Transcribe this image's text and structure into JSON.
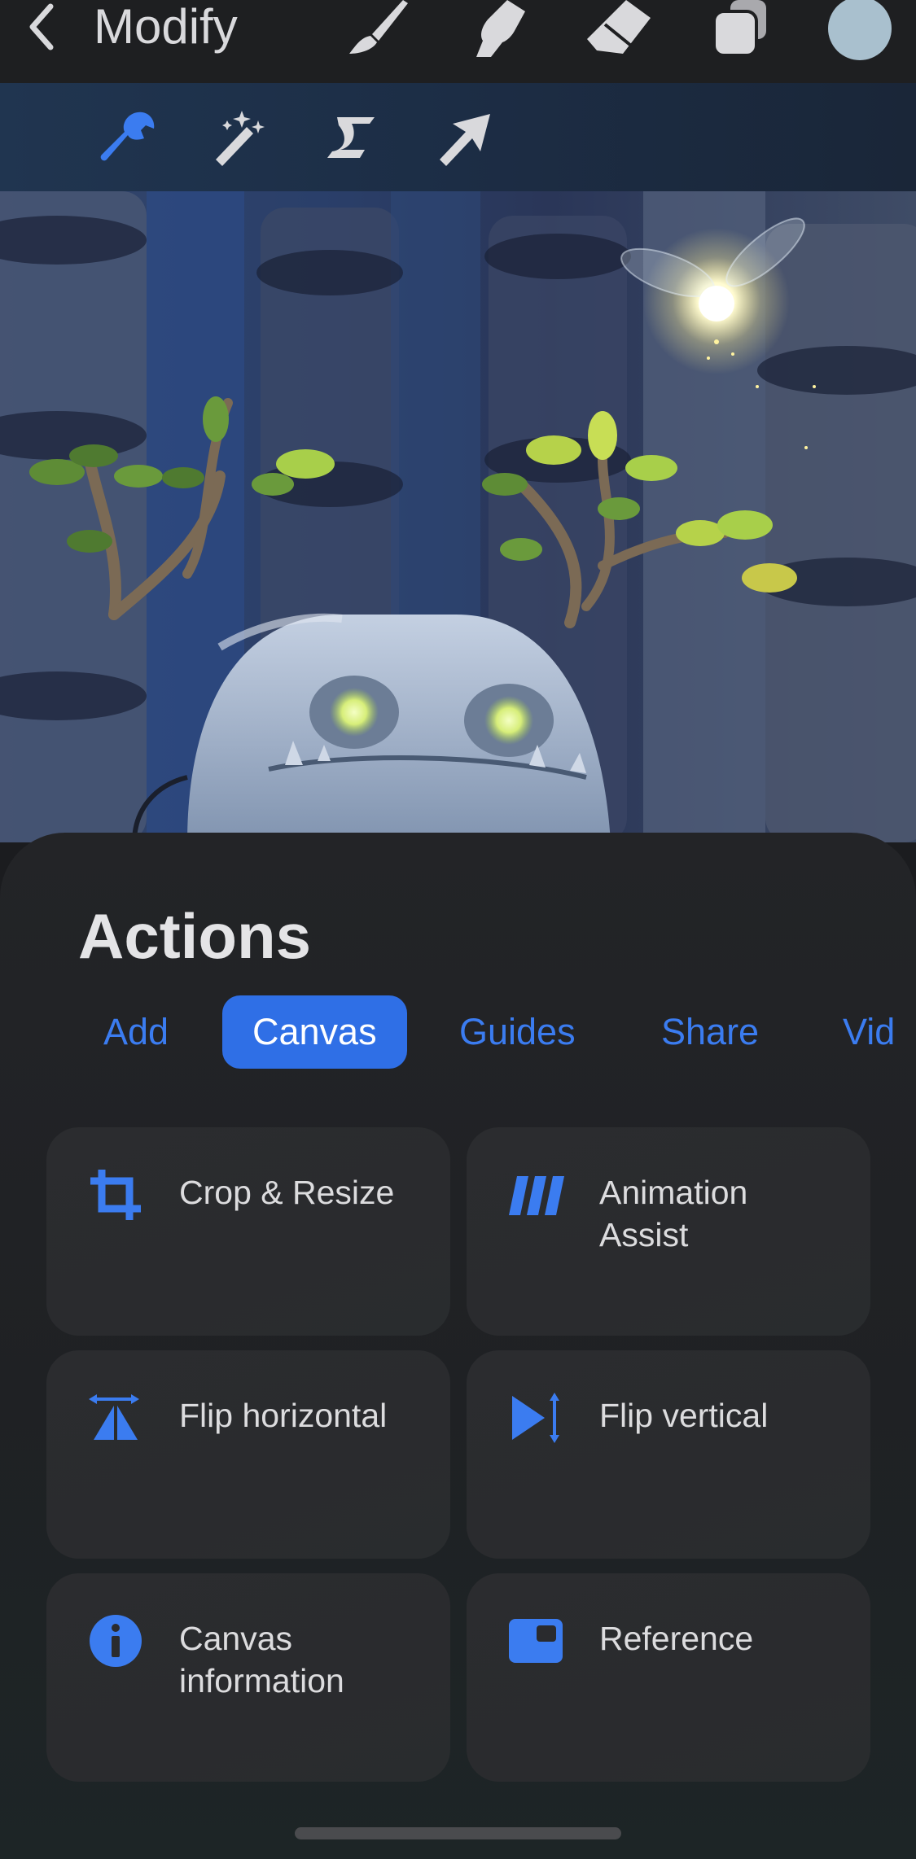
{
  "topbar": {
    "title": "Modify",
    "tools": [
      "brush-icon",
      "smudge-icon",
      "eraser-icon",
      "layers-icon"
    ],
    "current_color": "#a9c0ce"
  },
  "subbar": {
    "tools": [
      "actions-wrench-icon",
      "adjustments-magic-wand-icon",
      "selection-icon",
      "transform-arrow-icon"
    ],
    "accent": "#3b7cf0"
  },
  "actions": {
    "title": "Actions",
    "tabs": [
      {
        "label": "Add"
      },
      {
        "label": "Canvas"
      },
      {
        "label": "Guides"
      },
      {
        "label": "Share"
      },
      {
        "label": "Vid"
      }
    ],
    "active_tab": "Canvas",
    "items": [
      {
        "label": "Crop & Resize",
        "icon": "crop-icon"
      },
      {
        "label": "Animation Assist",
        "icon": "animation-assist-icon"
      },
      {
        "label": "Flip horizontal",
        "icon": "flip-horizontal-icon"
      },
      {
        "label": "Flip vertical",
        "icon": "flip-vertical-icon"
      },
      {
        "label": "Canvas information",
        "icon": "info-icon"
      },
      {
        "label": "Reference",
        "icon": "reference-icon"
      }
    ]
  }
}
